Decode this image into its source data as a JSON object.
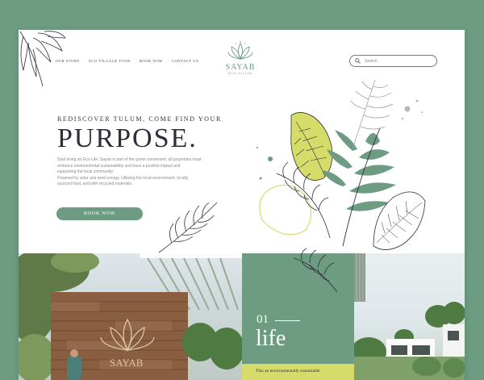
{
  "nav": {
    "items": [
      {
        "label": "OUR STORY"
      },
      {
        "label": "ECO VILLAGE TOUR"
      },
      {
        "label": "BOOK NOW"
      },
      {
        "label": "CONTACT US"
      }
    ]
  },
  "logo": {
    "title": "SAYAB",
    "subtitle": "ECO-VILLAS"
  },
  "search": {
    "placeholder": "Search"
  },
  "hero": {
    "kicker": "REDISCOVER TULUM, COME FIND YOUR",
    "headline": "PURPOSE.",
    "body_lines": [
      "Start living an Eco-Life. Sayab is part of the green movement; all properties must",
      "embrace environmental sustainability and have a positive impact and",
      "supporting the local community.",
      "Powered by solar and wind energy. Utilizing the local environment, locally",
      "sourced food, and with recycled materials."
    ],
    "cta_label": "BOOK NOW"
  },
  "feature": {
    "number": "01",
    "word": "life",
    "strip_text": "This an environmentally sustainable"
  },
  "colors": {
    "brand_green": "#6e9c83",
    "lime": "#d6dc6a",
    "ink": "#2e2e3a"
  }
}
